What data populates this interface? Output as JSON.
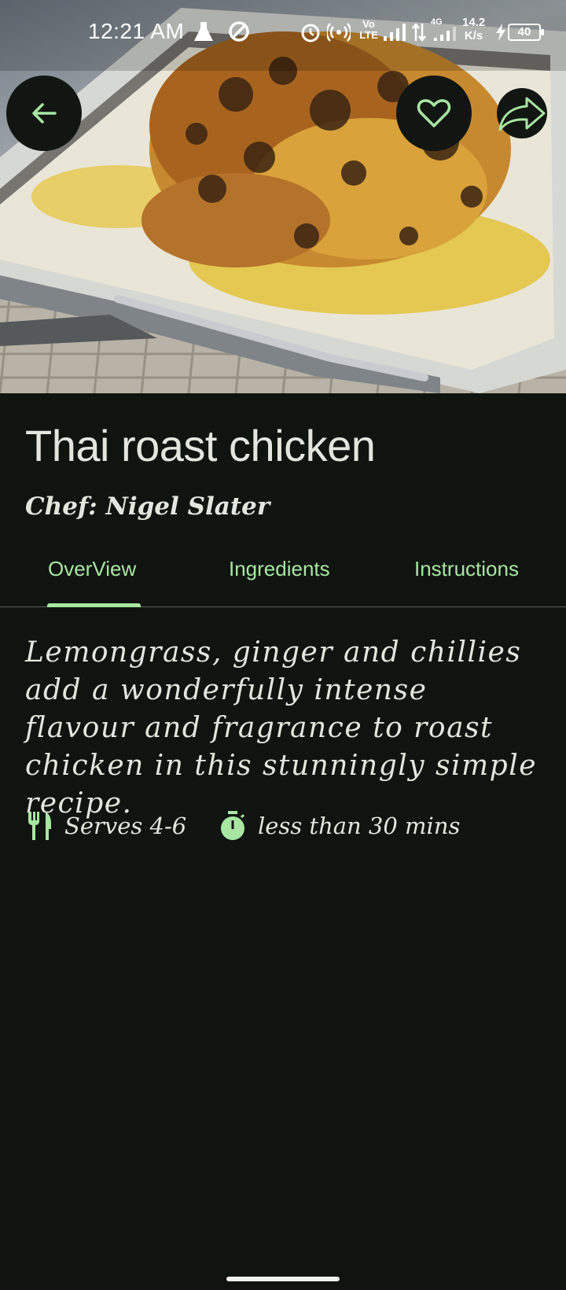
{
  "status_bar": {
    "time": "12:21 AM",
    "net_speed_value": "14.2",
    "net_speed_unit": "K/s",
    "battery": "40",
    "volte": "Vo LTE",
    "network": "4G"
  },
  "recipe": {
    "title": "Thai roast chicken",
    "chef": "Chef: Nigel Slater",
    "description": "Lemongrass, ginger and chillies add a wonderfully intense flavour and fragrance to roast chicken in this stunningly simple recipe.",
    "serves": "Serves 4-6",
    "time": "less than 30 mins"
  },
  "tabs": [
    {
      "label": "OverView",
      "selected": true
    },
    {
      "label": "Ingredients",
      "selected": false
    },
    {
      "label": "Instructions",
      "selected": false
    }
  ],
  "icons": {
    "back": "arrow-back-icon",
    "favorite": "heart-outline-icon",
    "share": "share-icon",
    "serves": "restaurant-icon",
    "time": "timer-icon"
  },
  "colors": {
    "background": "#101410",
    "accent": "#a8e6a2",
    "text": "#e2e6dd"
  }
}
